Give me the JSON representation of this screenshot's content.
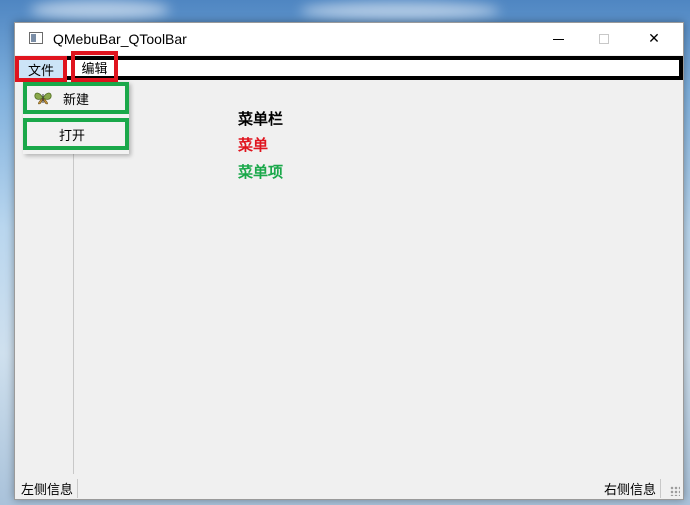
{
  "window": {
    "title": "QMebuBar_QToolBar",
    "controls": {
      "minimize": "—",
      "maximize": "☐",
      "close": "✕"
    }
  },
  "menubar": {
    "items": [
      {
        "label": "文件"
      },
      {
        "label": "编辑"
      }
    ]
  },
  "file_menu": {
    "items": [
      {
        "label": "新建",
        "icon": "butterfly-icon"
      },
      {
        "label": "打开"
      }
    ]
  },
  "content": {
    "labels": [
      {
        "text": "菜单栏",
        "color": "#000000"
      },
      {
        "text": "菜单",
        "color": "#e0141e"
      },
      {
        "text": "菜单项",
        "color": "#1aa84a"
      }
    ]
  },
  "statusbar": {
    "left": "左侧信息",
    "right": "右侧信息"
  },
  "colors": {
    "highlight_red": "#e0141e",
    "highlight_green": "#1aa84a",
    "menubar_border": "#000000"
  }
}
